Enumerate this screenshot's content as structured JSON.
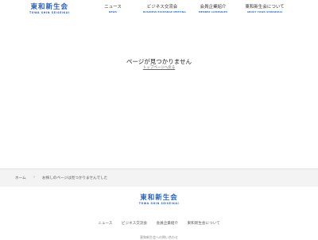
{
  "header": {
    "logo_title": "東和新生会",
    "logo_subtitle": "TOWA SHIN SEISEIKAI",
    "nav": [
      {
        "label": "ニュース",
        "sub": "NEWS"
      },
      {
        "label": "ビジネス交流会",
        "sub": "BUSINESS EXCHANGE MEETING"
      },
      {
        "label": "会員企業紹介",
        "sub": "MEMBER COMPANIES"
      },
      {
        "label": "東和新生会について",
        "sub": "ABOUT TOWA SHINSEIKAI"
      }
    ]
  },
  "main": {
    "title": "ページが見つかりません",
    "top_link": "トップページへ戻る"
  },
  "breadcrumb": {
    "home": "ホーム",
    "separator": "›",
    "current": "お探しのページは見つかりませんでした"
  },
  "footer": {
    "logo_title": "東和新生会",
    "logo_subtitle": "TOWA SHIN SEISEIKAI",
    "nav": [
      "ニュース",
      "ビジネス交流会",
      "会員企業紹介",
      "東和新生会について"
    ],
    "bottom_text": "東和新生会への問い合わせ"
  }
}
